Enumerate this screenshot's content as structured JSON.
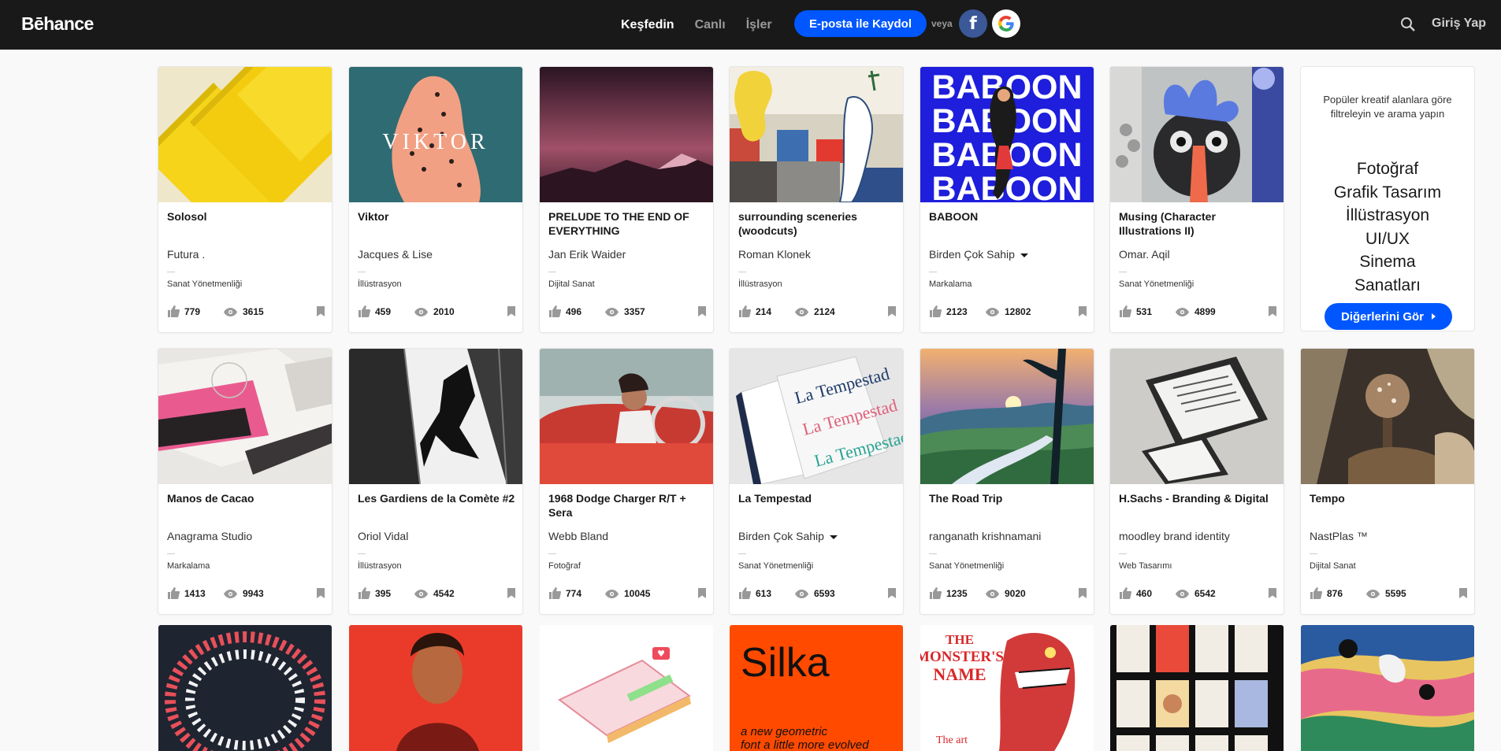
{
  "header": {
    "logo": "Bēhance",
    "nav": [
      "Keşfedin",
      "Canlı",
      "İşler"
    ],
    "signup_label": "E-posta ile Kaydol",
    "or_label": "veya",
    "facebook_glyph": "f",
    "google_glyph": "G",
    "login_label": "Giriş Yap"
  },
  "projects": [
    {
      "title": "Solosol",
      "owner": "Futura .",
      "multi_owner": false,
      "field": "Sanat Yönetmenliği",
      "appreciations": "779",
      "views": "3615"
    },
    {
      "title": "Viktor",
      "owner": "Jacques & Lise",
      "multi_owner": false,
      "field": "İllüstrasyon",
      "appreciations": "459",
      "views": "2010"
    },
    {
      "title": "PRELUDE TO THE END OF EVERYTHING",
      "owner": "Jan Erik Waider",
      "multi_owner": false,
      "field": "Dijital Sanat",
      "appreciations": "496",
      "views": "3357"
    },
    {
      "title": "surrounding sceneries (woodcuts)",
      "owner": "Roman Klonek",
      "multi_owner": false,
      "field": "İllüstrasyon",
      "appreciations": "214",
      "views": "2124"
    },
    {
      "title": "BABOON",
      "owner": "Birden Çok Sahip",
      "multi_owner": true,
      "field": "Markalama",
      "appreciations": "2123",
      "views": "12802"
    },
    {
      "title": "Musing (Character Illustrations II)",
      "owner": "Omar. Aqil",
      "multi_owner": false,
      "field": "Sanat Yönetmenliği",
      "appreciations": "531",
      "views": "4899"
    },
    {
      "title": "Manos de Cacao",
      "owner": "Anagrama Studio",
      "multi_owner": false,
      "field": "Markalama",
      "appreciations": "1413",
      "views": "9943"
    },
    {
      "title": "Les Gardiens de la Comète #2",
      "owner": "Oriol Vidal",
      "multi_owner": false,
      "field": "İllüstrasyon",
      "appreciations": "395",
      "views": "4542"
    },
    {
      "title": "1968 Dodge Charger R/T + Sera",
      "owner": "Webb Bland",
      "multi_owner": false,
      "field": "Fotoğraf",
      "appreciations": "774",
      "views": "10045"
    },
    {
      "title": "La Tempestad",
      "owner": "Birden Çok Sahip",
      "multi_owner": true,
      "field": "Sanat Yönetmenliği",
      "appreciations": "613",
      "views": "6593"
    },
    {
      "title": "The Road Trip",
      "owner": "ranganath krishnamani",
      "multi_owner": false,
      "field": "Sanat Yönetmenliği",
      "appreciations": "1235",
      "views": "9020"
    },
    {
      "title": "H.Sachs - Branding & Digital",
      "owner": "moodley brand identity",
      "multi_owner": false,
      "field": "Web Tasarımı",
      "appreciations": "460",
      "views": "6542"
    },
    {
      "title": "Tempo",
      "owner": "NastPlas ™",
      "multi_owner": false,
      "field": "Dijital Sanat",
      "appreciations": "876",
      "views": "5595"
    }
  ],
  "filter_panel": {
    "intro": "Popüler kreatif alanlara göre filtreleyin ve arama yapın",
    "fields": [
      "Fotoğraf",
      "Grafik Tasarım",
      "İllüstrasyon",
      "UI/UX",
      "Sinema",
      "Sanatları"
    ],
    "more_label": "Diğerlerini Gör"
  },
  "thumb_text": {
    "viktor": "VIKTOR",
    "baboon": "BABOON",
    "la_tempestad": "La Tempestad",
    "silka_word": "Silka",
    "silka_tagline_1": "a new geometric",
    "silka_tagline_2": "font a little more evolved",
    "monster_title_1": "THE",
    "monster_title_2": "MONSTER'S",
    "monster_title_3": "NAME",
    "monster_sub": "The art"
  },
  "colors": {
    "accent": "#0057ff",
    "topbar": "#191919"
  }
}
